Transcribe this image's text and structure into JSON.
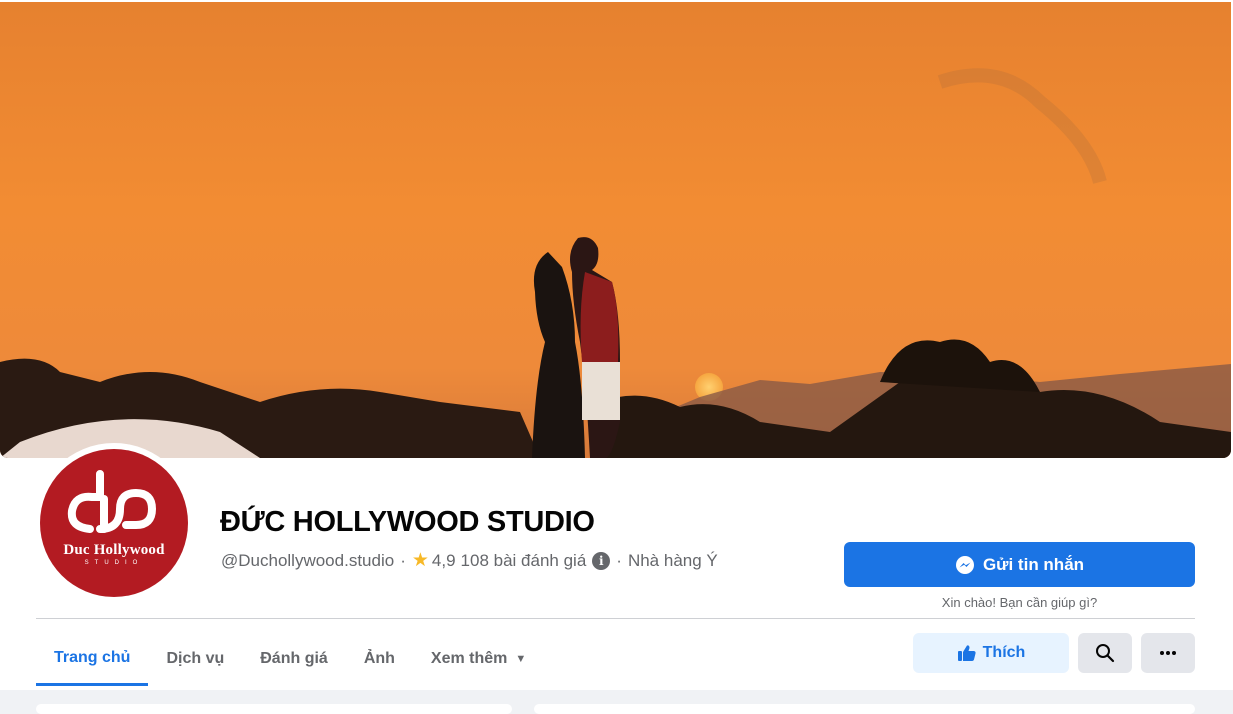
{
  "page": {
    "name": "ĐỨC HOLLYWOOD STUDIO",
    "handle": "@Duchollywood.studio",
    "separator": "·",
    "rating": "4,9",
    "reviews": "108 bài đánh giá",
    "category": "Nhà hàng Ý"
  },
  "avatar": {
    "brand_line1": "Duc Hollywood",
    "brand_line2": "STUDIO"
  },
  "actions": {
    "message_label": "Gửi tin nhắn",
    "greeting": "Xin chào! Bạn cần giúp gì?",
    "like_label": "Thích"
  },
  "tabs": [
    {
      "label": "Trang chủ",
      "active": true
    },
    {
      "label": "Dịch vụ"
    },
    {
      "label": "Đánh giá"
    },
    {
      "label": "Ảnh"
    },
    {
      "label": "Xem thêm"
    }
  ],
  "icons": {
    "messenger": "messenger-icon",
    "like": "thumbs-up-icon",
    "search": "search-icon",
    "more": "more-icon",
    "rating": "star-icon",
    "info": "info-icon"
  },
  "colors": {
    "accent": "#1b74e4",
    "like_bg": "#e7f3ff",
    "avatar_bg": "#b31b22",
    "sky": "#f08a30"
  }
}
